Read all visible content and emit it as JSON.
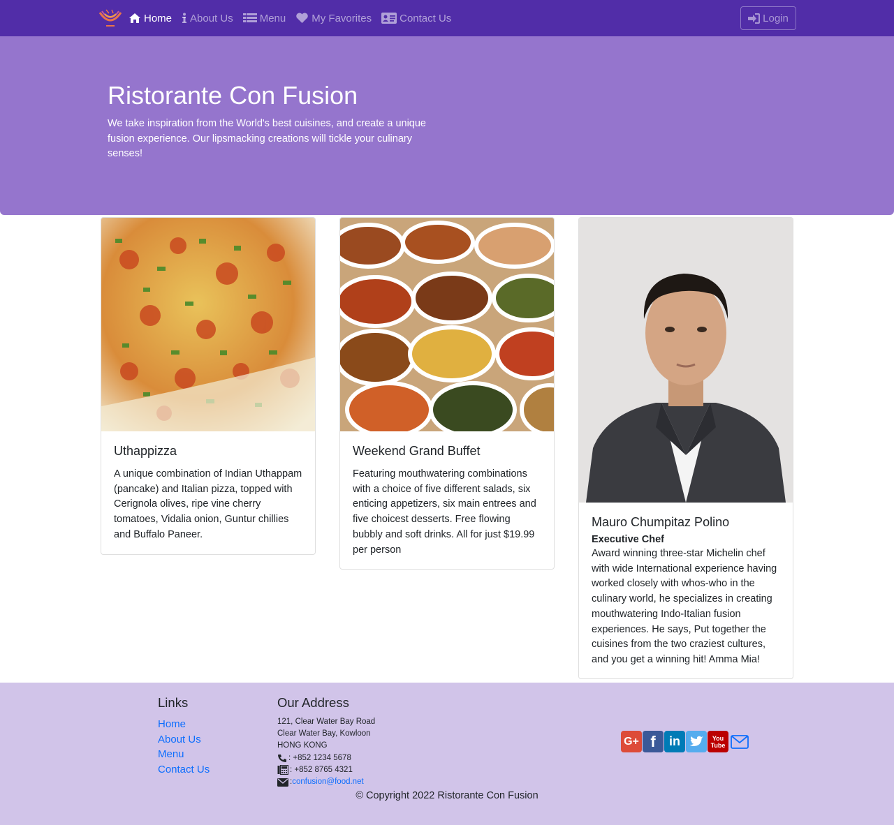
{
  "navbar": {
    "brand_icon": "restaurant-logo",
    "items": [
      {
        "label": "Home",
        "icon": "home-icon",
        "active": true
      },
      {
        "label": "About Us",
        "icon": "info-icon",
        "active": false
      },
      {
        "label": "Menu",
        "icon": "list-icon",
        "active": false
      },
      {
        "label": "My Favorites",
        "icon": "heart-icon",
        "active": false
      },
      {
        "label": "Contact Us",
        "icon": "address-card-icon",
        "active": false
      }
    ],
    "login_label": "Login"
  },
  "jumbotron": {
    "title": "Ristorante Con Fusion",
    "text": "We take inspiration from the World's best cuisines, and create a unique fusion experience. Our lipsmacking creations will tickle your culinary senses!"
  },
  "cards": [
    {
      "image": "pizza-photo",
      "title": "Uthappizza",
      "text": "A unique combination of Indian Uthappam (pancake) and Italian pizza, topped with Cerignola olives, ripe vine cherry tomatoes, Vidalia onion, Guntur chillies and Buffalo Paneer."
    },
    {
      "image": "buffet-photo",
      "title": "Weekend Grand Buffet",
      "text": "Featuring mouthwatering combinations with a choice of five different salads, six enticing appetizers, six main entrees and five choicest desserts. Free flowing bubbly and soft drinks. All for just $19.99 per person"
    },
    {
      "image": "chef-photo",
      "title": "Mauro Chumpitaz Polino",
      "subtitle": "Executive Chef",
      "text": "Award winning three-star Michelin chef with wide International experience having worked closely with whos-who in the culinary world, he specializes in creating mouthwatering Indo-Italian fusion experiences. He says, Put together the cuisines from the two craziest cultures, and you get a winning hit! Amma Mia!"
    }
  ],
  "footer": {
    "links_heading": "Links",
    "links": [
      "Home",
      "About Us",
      "Menu",
      "Contact Us"
    ],
    "address_heading": "Our Address",
    "address_lines": [
      "121, Clear Water Bay Road",
      "Clear Water Bay, Kowloon",
      "HONG KONG"
    ],
    "phone": ": +852 1234 5678",
    "fax": ": +852 8765 4321",
    "email_prefix": ": ",
    "email": "confusion@food.net",
    "social": [
      {
        "name": "google-plus",
        "label": "G+",
        "color": "#dd4b39"
      },
      {
        "name": "facebook",
        "label": "f",
        "color": "#3b5998"
      },
      {
        "name": "linkedin",
        "label": "in",
        "color": "#007bb6"
      },
      {
        "name": "twitter",
        "label": "t",
        "color": "#55acee"
      },
      {
        "name": "youtube",
        "label": "You Tube",
        "color": "#bb0000"
      }
    ],
    "copyright": "© Copyright 2022 Ristorante Con Fusion"
  },
  "colors": {
    "primary": "#512da8",
    "primary_light": "#9575cd",
    "footer_bg": "#d1c4e9",
    "link": "#0d6efd"
  }
}
